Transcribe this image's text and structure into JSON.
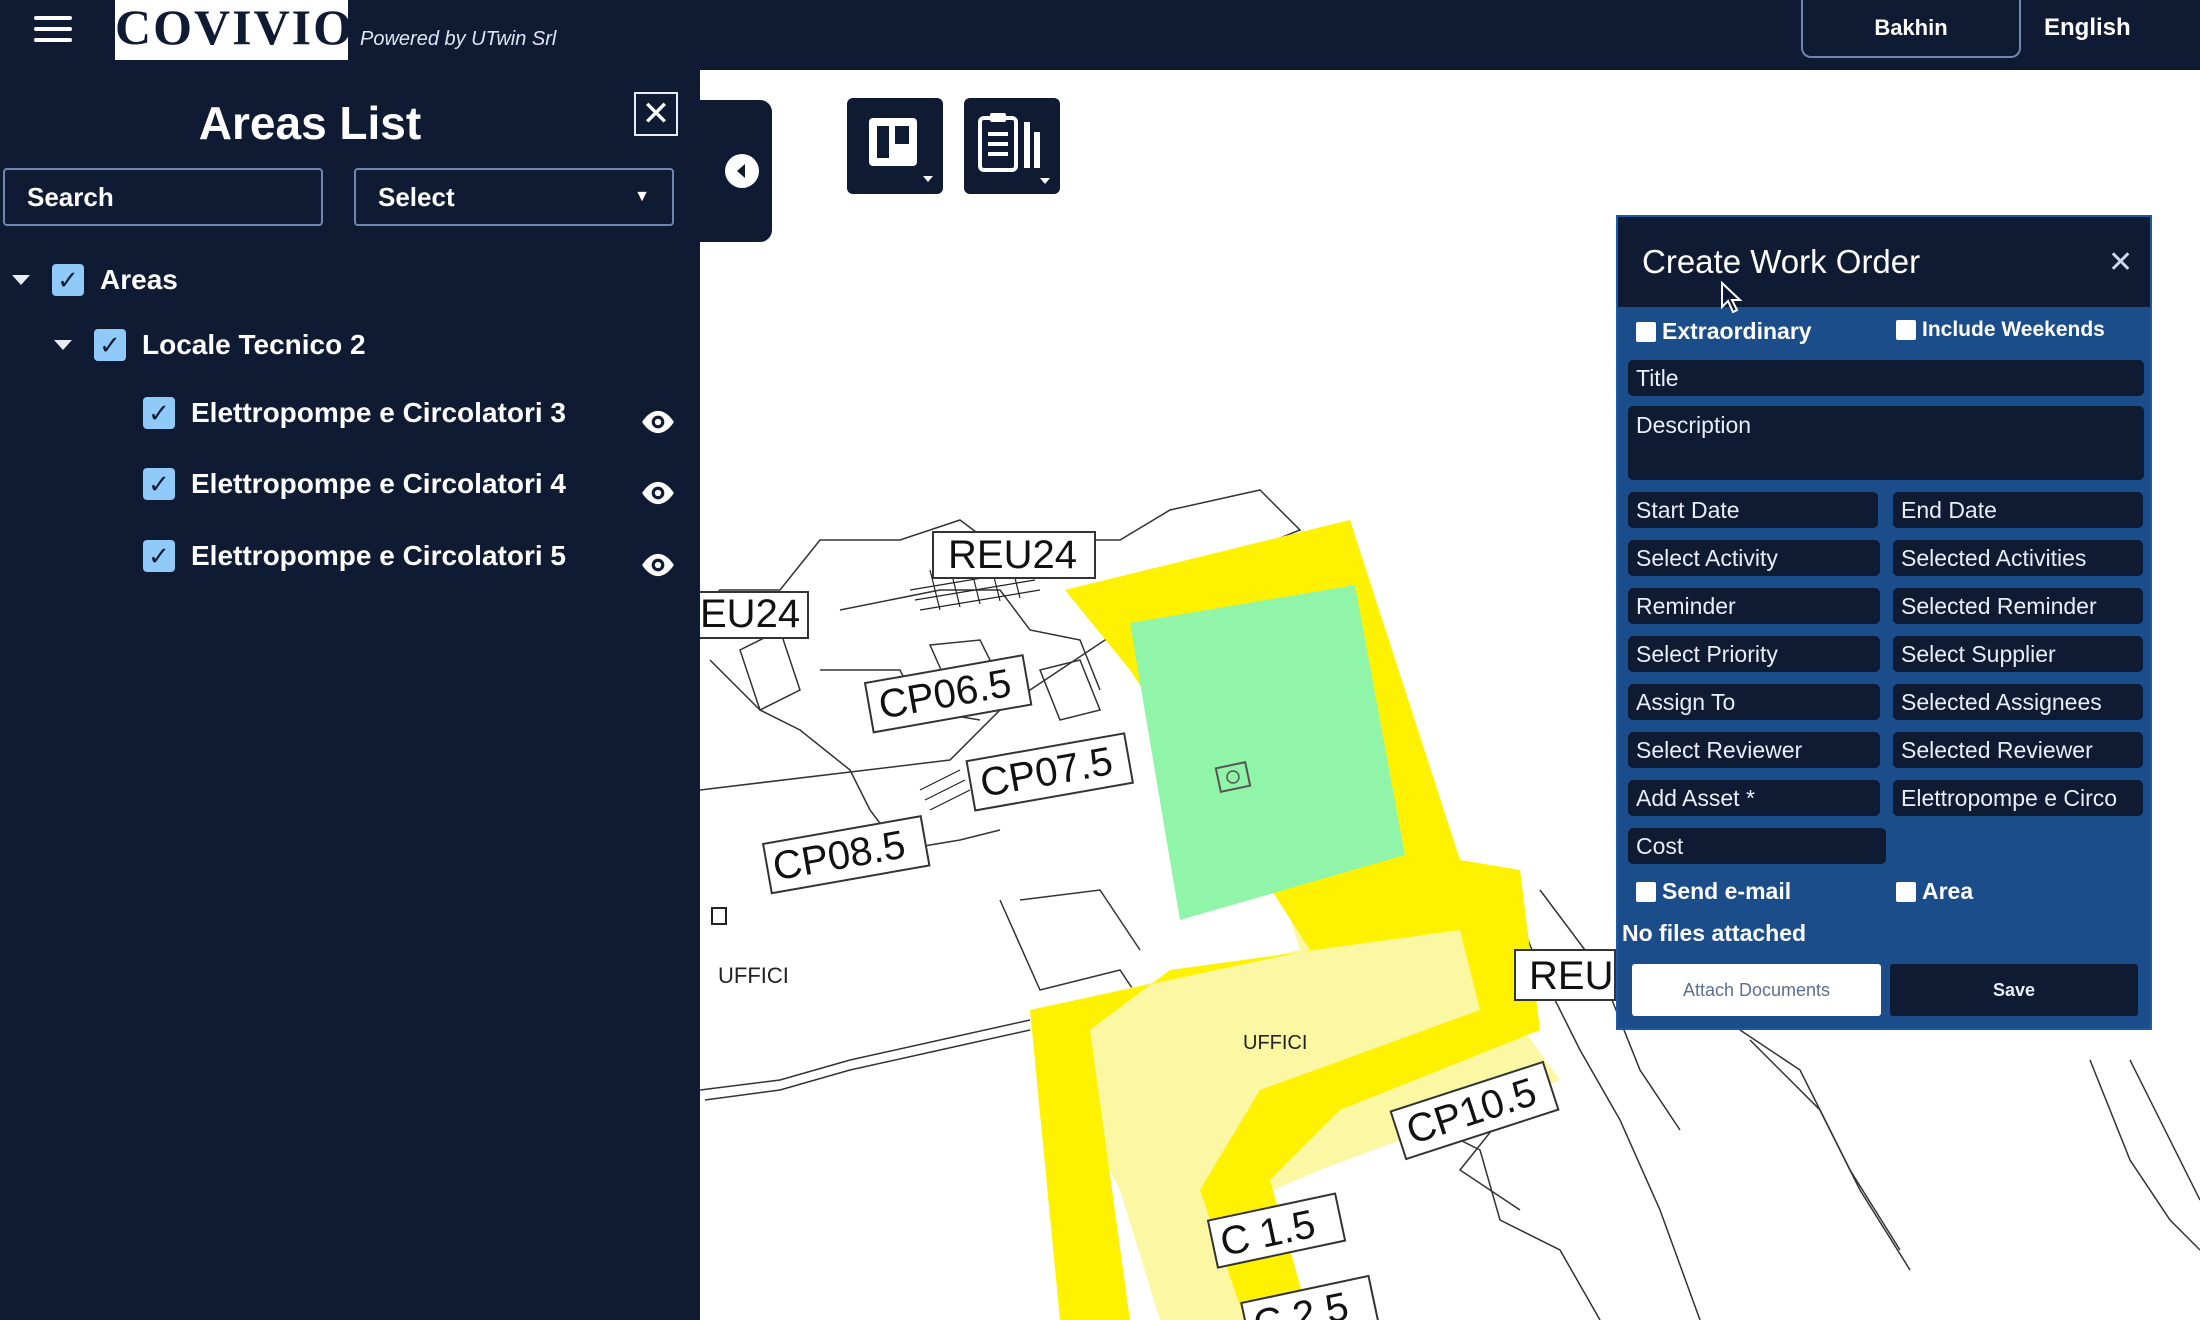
{
  "header": {
    "logo_text": "COVIVIO",
    "powered_by": "Powered by UTwin Srl",
    "top_button_label": "Bakhin",
    "language": "English"
  },
  "sidebar": {
    "title": "Areas List",
    "search_placeholder": "Search",
    "select_label": "Select",
    "tree": {
      "root": "Areas",
      "group": "Locale Tecnico 2",
      "items": [
        {
          "label": "Elettropompe e Circolatori 3"
        },
        {
          "label": "Elettropompe e Circolatori 4"
        },
        {
          "label": "Elettropompe e Circolatori 5"
        }
      ]
    }
  },
  "map": {
    "labels": {
      "reu24_a": "REU24",
      "reu24_b": "EU24",
      "cp06": "CP06.5",
      "cp07": "CP07.5",
      "cp08": "CP08.5",
      "cp10": "CP10.5",
      "c15": "C  1.5",
      "c25": "C  2.5",
      "reu_right": "REU",
      "uffici_left": "UFFICI",
      "uffici_center": "UFFICI"
    },
    "colors": {
      "highlight_yellow": "#fff200",
      "pale_yellow": "#fbf7a2",
      "green_area": "#90f5a8"
    }
  },
  "work_order": {
    "title": "Create Work Order",
    "extraordinary": "Extraordinary",
    "include_weekends": "Include Weekends",
    "title_field": "Title",
    "description_field": "Description",
    "start_date": "Start Date",
    "end_date": "End Date",
    "select_activity": "Select Activity",
    "selected_activities": "Selected Activities",
    "reminder": "Reminder",
    "selected_reminder": "Selected Reminder",
    "select_priority": "Select Priority",
    "select_supplier": "Select Supplier",
    "assign_to": "Assign To",
    "selected_assignees": "Selected Assignees",
    "select_reviewer": "Select Reviewer",
    "selected_reviewer": "Selected Reviewer",
    "add_asset": "Add Asset *",
    "asset_value": "Elettropompe e Circo",
    "cost": "Cost",
    "send_email": "Send e-mail",
    "area": "Area",
    "no_files": "No files attached",
    "attach_button": "Attach Documents",
    "save_button": "Save"
  }
}
